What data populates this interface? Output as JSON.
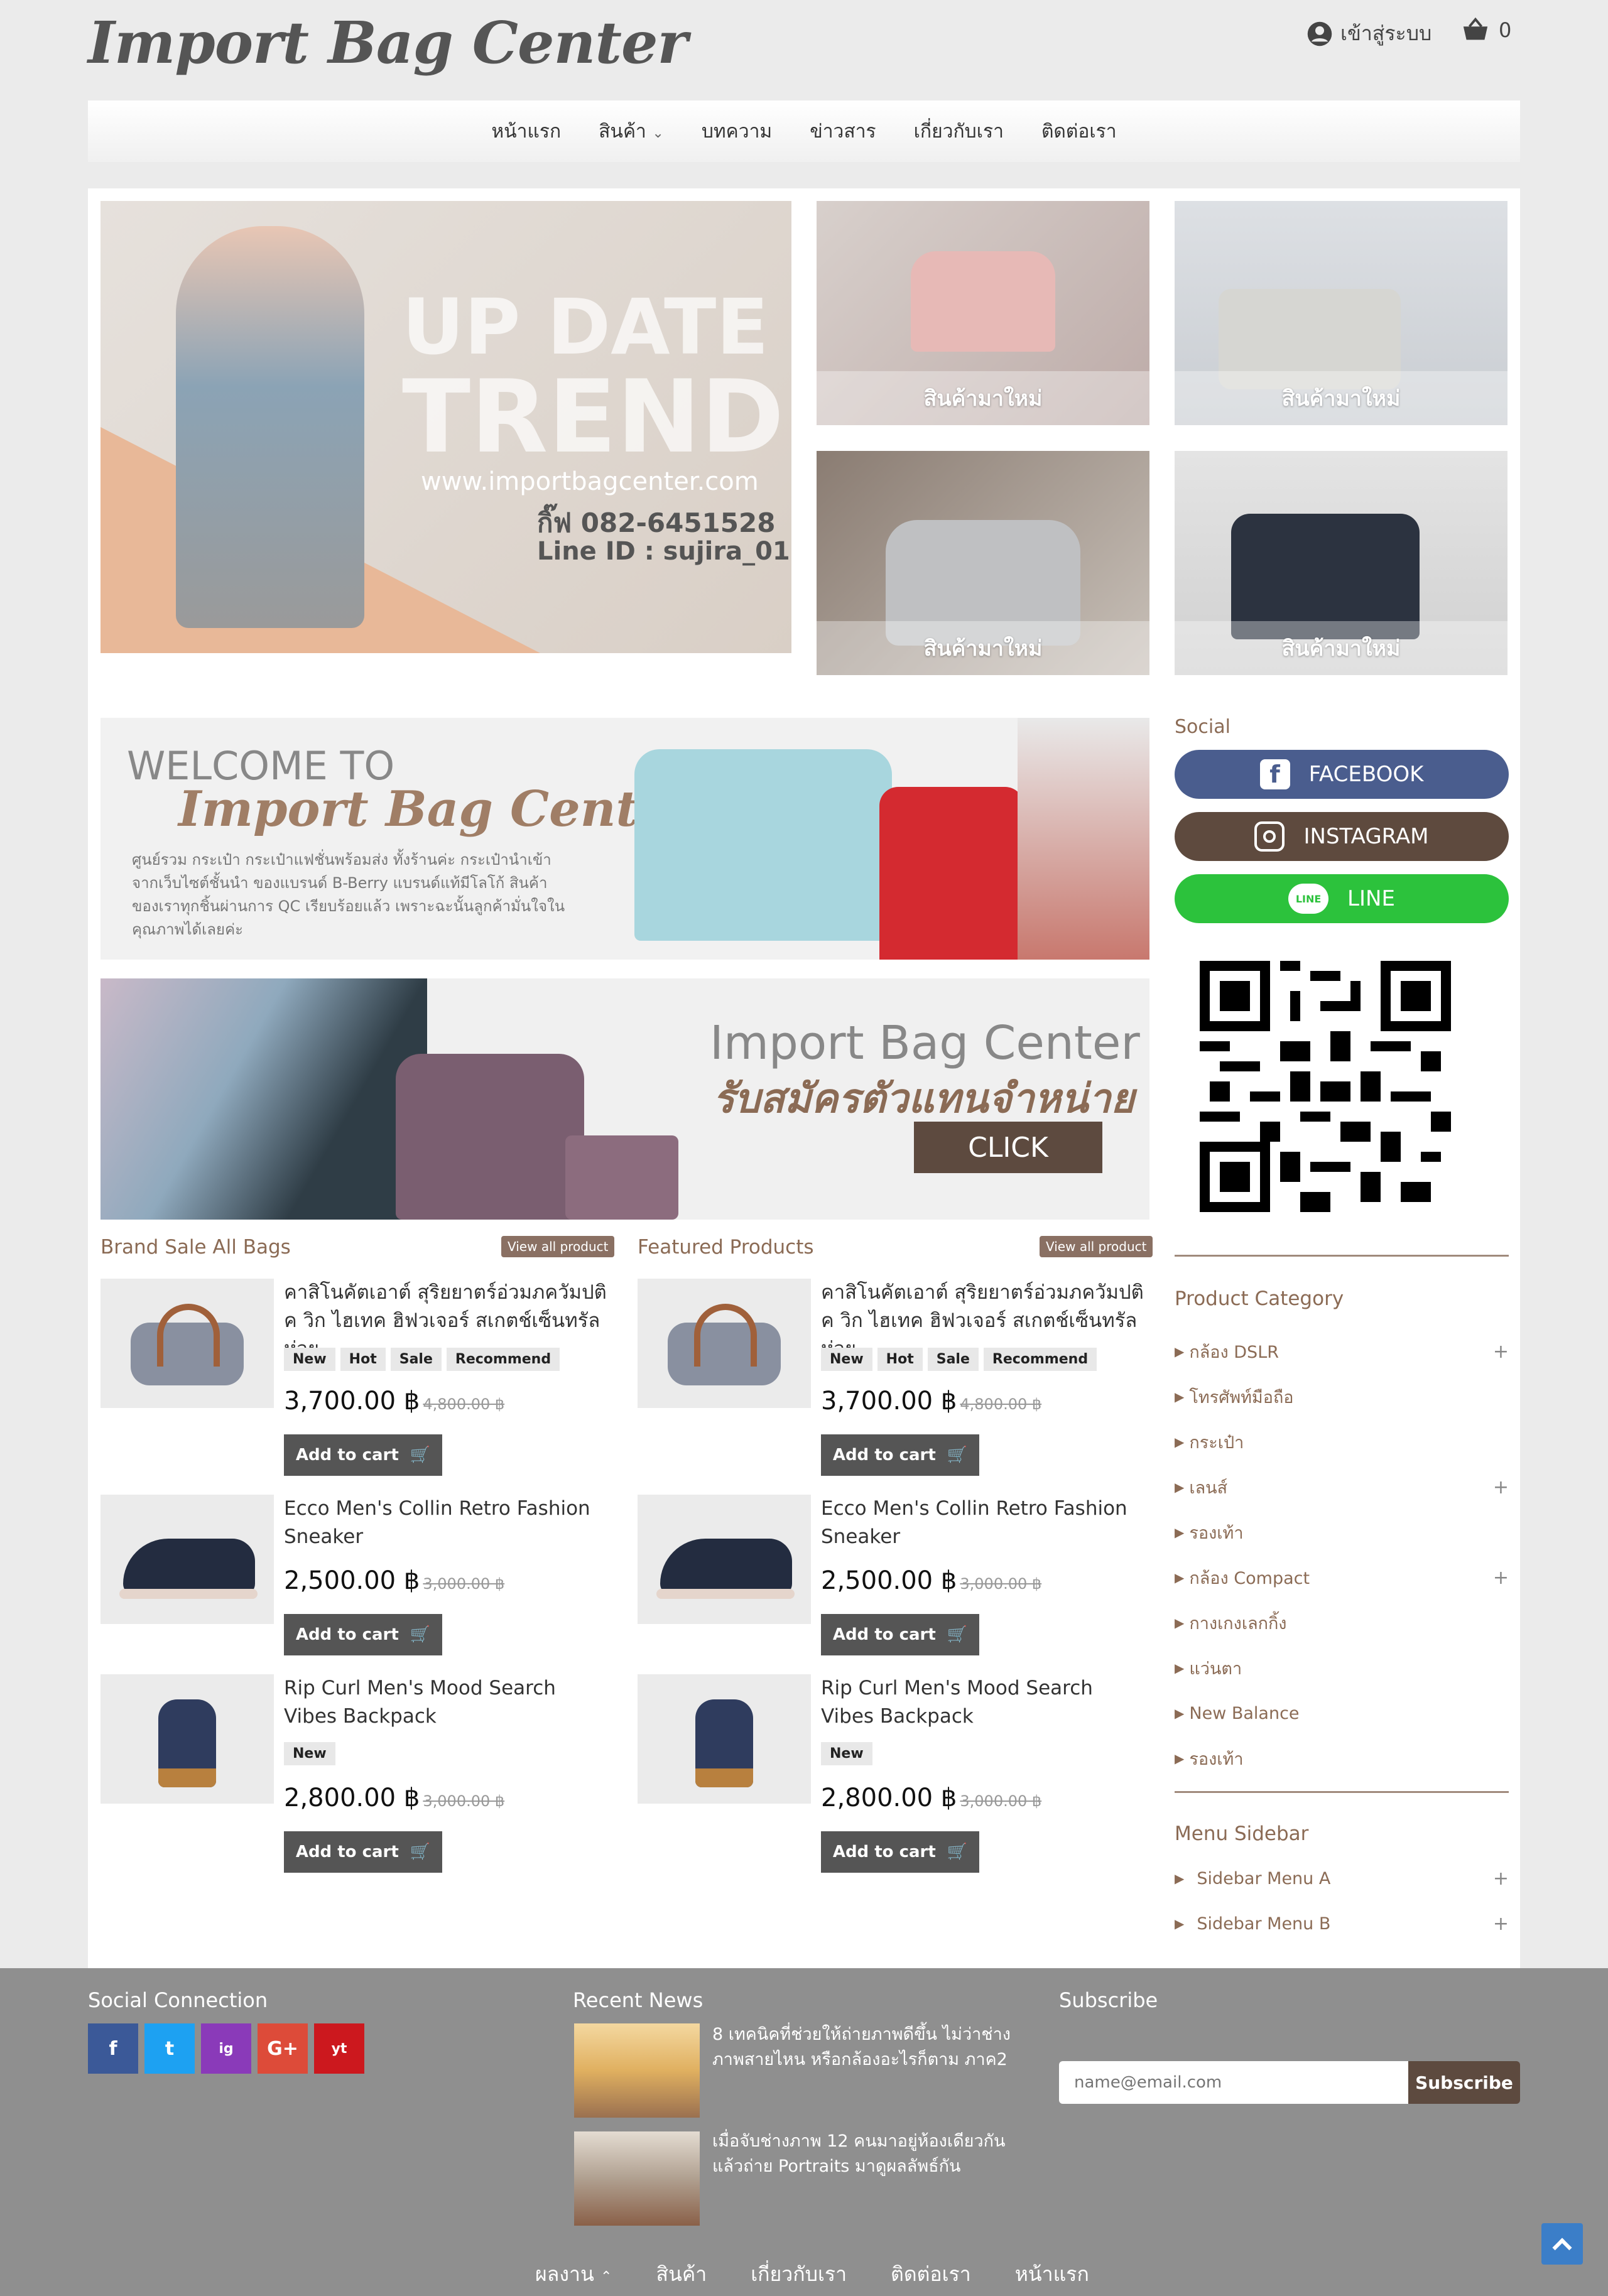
{
  "header": {
    "logo": "Import Bag Center",
    "login_label": "เข้าสู่ระบบ",
    "cart_count": "0",
    "icons": {
      "user": "user-circle-icon",
      "cart": "shopping-basket-icon"
    }
  },
  "nav": {
    "items": [
      "หน้าแรก",
      "สินค้า",
      "บทความ",
      "ข่าวสาร",
      "เกี่ยวกับเรา",
      "ติดต่อเรา"
    ]
  },
  "hero": {
    "line1": "UP DATE",
    "line2": "TREND",
    "url": "www.importbagcenter.com",
    "phone": "กิ๊ฟ 082-6451528",
    "line_id": "Line ID : sujira_01"
  },
  "tiles": [
    "สินค้ามาใหม่",
    "สินค้ามาใหม่",
    "สินค้ามาใหม่",
    "สินค้ามาใหม่"
  ],
  "welcome": {
    "welcome": "WELCOME TO",
    "brand": "Import Bag Center",
    "desc": "ศูนย์รวม กระเป๋า กระเป๋าแฟชั่นพร้อมส่ง ทั้งร้านค่ะ กระเป๋านำเข้าจากเว็บไซต์ชั้นนำ ของแบรนด์ B-Berry แบรนด์แท้มีโลโก้ สินค้าของเราทุกชิ้นผ่านการ QC เรียบร้อยแล้ว เพราะฉะนั้นลูกค้ามั่นใจในคุณภาพได้เลยค่ะ"
  },
  "agent": {
    "brand": "Import Bag Center",
    "tagline": "รับสมัครตัวแทนจำหน่าย",
    "cta": "CLICK"
  },
  "columns": [
    {
      "title": "Brand Sale All Bags",
      "view_all": "View all product",
      "products": [
        {
          "name": "คาสิโนคัตเอาต์ สุริยยาตร์อ่วมภควัมปติค วิก ไฮเทค ฮิฟวเจอร์ สเกตช์เซ็นทรัลห่วย",
          "badges": [
            "New",
            "Hot",
            "Sale",
            "Recommend"
          ],
          "price": "3,700.00 ฿",
          "old": "4,800.00 ฿",
          "cta": "Add to cart"
        },
        {
          "name": "Ecco Men's Collin Retro Fashion Sneaker",
          "badges": [],
          "price": "2,500.00 ฿",
          "old": "3,000.00 ฿",
          "cta": "Add to cart"
        },
        {
          "name": "Rip Curl Men's Mood Search Vibes Backpack",
          "badges": [
            "New"
          ],
          "price": "2,800.00 ฿",
          "old": "3,000.00 ฿",
          "cta": "Add to cart"
        }
      ]
    },
    {
      "title": "Featured Products",
      "view_all": "View all product",
      "products": [
        {
          "name": "คาสิโนคัตเอาต์ สุริยยาตร์อ่วมภควัมปติค วิก ไฮเทค ฮิฟวเจอร์ สเกตช์เซ็นทรัลห่วย",
          "badges": [
            "New",
            "Hot",
            "Sale",
            "Recommend"
          ],
          "price": "3,700.00 ฿",
          "old": "4,800.00 ฿",
          "cta": "Add to cart"
        },
        {
          "name": "Ecco Men's Collin Retro Fashion Sneaker",
          "badges": [],
          "price": "2,500.00 ฿",
          "old": "3,000.00 ฿",
          "cta": "Add to cart"
        },
        {
          "name": "Rip Curl Men's Mood Search Vibes Backpack",
          "badges": [
            "New"
          ],
          "price": "2,800.00 ฿",
          "old": "3,000.00 ฿",
          "cta": "Add to cart"
        }
      ]
    }
  ],
  "sidebar": {
    "social_title": "Social",
    "facebook": "FACEBOOK",
    "instagram": "INSTAGRAM",
    "line": "LINE",
    "line_badge": "LINE",
    "colors": {
      "facebook": "#4a5d8e",
      "instagram": "#5e4a3e",
      "line": "#2cc23c"
    },
    "category_title": "Product Category",
    "categories": [
      {
        "label": "กล้อง DSLR",
        "plus": true
      },
      {
        "label": "โทรศัพท์มือถือ",
        "plus": false
      },
      {
        "label": "กระเป๋า",
        "plus": false
      },
      {
        "label": "เลนส์",
        "plus": true
      },
      {
        "label": "รองเท้า",
        "plus": false
      },
      {
        "label": "กล้อง Compact",
        "plus": true
      },
      {
        "label": "กางเกงเลกกิ้ง",
        "plus": false
      },
      {
        "label": "แว่นตา",
        "plus": false
      },
      {
        "label": "New Balance",
        "plus": false
      },
      {
        "label": "รองเท้า",
        "plus": false
      }
    ],
    "menu_title": "Menu Sidebar",
    "menus": [
      "Sidebar Menu A",
      "Sidebar Menu B"
    ]
  },
  "footer": {
    "social_title": "Social Connection",
    "social_icons": [
      "f",
      "t",
      "ig",
      "G+",
      "yt"
    ],
    "social_colors": [
      "#3b5998",
      "#1da1f2",
      "#8a3ab9",
      "#dd4b39",
      "#cc181e"
    ],
    "news_title": "Recent News",
    "news": [
      "8 เทคนิคที่ช่วยให้ถ่ายภาพดีขึ้น ไม่ว่าช่างภาพสายไหน หรือกล้องอะไรก็ตาม ภาค2",
      "เมื่อจับช่างภาพ 12 คนมาอยู่ห้องเดียวกันแล้วถ่าย Portraits มาดูผลลัพธ์กัน"
    ],
    "subscribe_title": "Subscribe",
    "email_placeholder": "name@email.com",
    "subscribe_btn": "Subscribe",
    "bottom_nav": [
      "ผลงาน",
      "สินค้า",
      "เกี่ยวกับเรา",
      "ติดต่อเรา",
      "หน้าแรก"
    ]
  }
}
